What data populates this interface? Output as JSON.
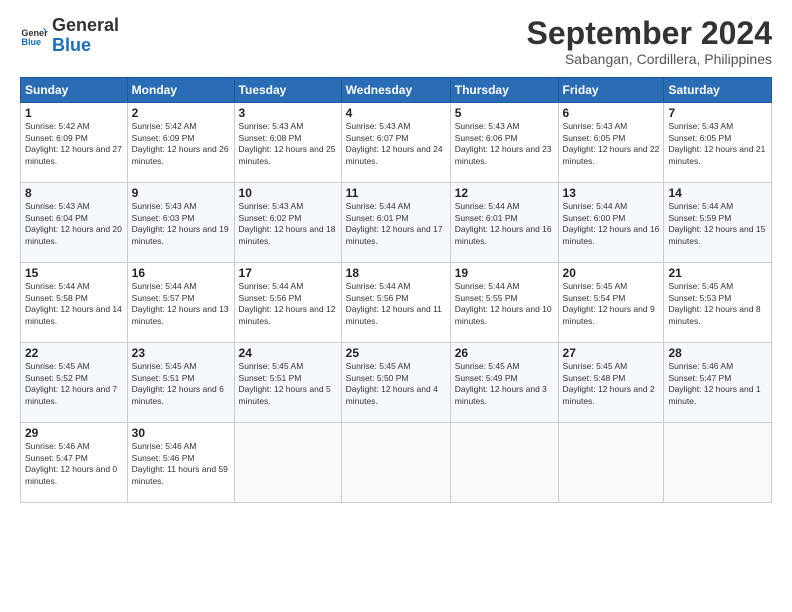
{
  "header": {
    "logo_line1": "General",
    "logo_line2": "Blue",
    "month_title": "September 2024",
    "subtitle": "Sabangan, Cordillera, Philippines"
  },
  "days_of_week": [
    "Sunday",
    "Monday",
    "Tuesday",
    "Wednesday",
    "Thursday",
    "Friday",
    "Saturday"
  ],
  "weeks": [
    [
      {
        "day": "1",
        "sunrise": "5:42 AM",
        "sunset": "6:09 PM",
        "daylight": "12 hours and 27 minutes."
      },
      {
        "day": "2",
        "sunrise": "5:42 AM",
        "sunset": "6:09 PM",
        "daylight": "12 hours and 26 minutes."
      },
      {
        "day": "3",
        "sunrise": "5:43 AM",
        "sunset": "6:08 PM",
        "daylight": "12 hours and 25 minutes."
      },
      {
        "day": "4",
        "sunrise": "5:43 AM",
        "sunset": "6:07 PM",
        "daylight": "12 hours and 24 minutes."
      },
      {
        "day": "5",
        "sunrise": "5:43 AM",
        "sunset": "6:06 PM",
        "daylight": "12 hours and 23 minutes."
      },
      {
        "day": "6",
        "sunrise": "5:43 AM",
        "sunset": "6:05 PM",
        "daylight": "12 hours and 22 minutes."
      },
      {
        "day": "7",
        "sunrise": "5:43 AM",
        "sunset": "6:05 PM",
        "daylight": "12 hours and 21 minutes."
      }
    ],
    [
      {
        "day": "8",
        "sunrise": "5:43 AM",
        "sunset": "6:04 PM",
        "daylight": "12 hours and 20 minutes."
      },
      {
        "day": "9",
        "sunrise": "5:43 AM",
        "sunset": "6:03 PM",
        "daylight": "12 hours and 19 minutes."
      },
      {
        "day": "10",
        "sunrise": "5:43 AM",
        "sunset": "6:02 PM",
        "daylight": "12 hours and 18 minutes."
      },
      {
        "day": "11",
        "sunrise": "5:44 AM",
        "sunset": "6:01 PM",
        "daylight": "12 hours and 17 minutes."
      },
      {
        "day": "12",
        "sunrise": "5:44 AM",
        "sunset": "6:01 PM",
        "daylight": "12 hours and 16 minutes."
      },
      {
        "day": "13",
        "sunrise": "5:44 AM",
        "sunset": "6:00 PM",
        "daylight": "12 hours and 16 minutes."
      },
      {
        "day": "14",
        "sunrise": "5:44 AM",
        "sunset": "5:59 PM",
        "daylight": "12 hours and 15 minutes."
      }
    ],
    [
      {
        "day": "15",
        "sunrise": "5:44 AM",
        "sunset": "5:58 PM",
        "daylight": "12 hours and 14 minutes."
      },
      {
        "day": "16",
        "sunrise": "5:44 AM",
        "sunset": "5:57 PM",
        "daylight": "12 hours and 13 minutes."
      },
      {
        "day": "17",
        "sunrise": "5:44 AM",
        "sunset": "5:56 PM",
        "daylight": "12 hours and 12 minutes."
      },
      {
        "day": "18",
        "sunrise": "5:44 AM",
        "sunset": "5:56 PM",
        "daylight": "12 hours and 11 minutes."
      },
      {
        "day": "19",
        "sunrise": "5:44 AM",
        "sunset": "5:55 PM",
        "daylight": "12 hours and 10 minutes."
      },
      {
        "day": "20",
        "sunrise": "5:45 AM",
        "sunset": "5:54 PM",
        "daylight": "12 hours and 9 minutes."
      },
      {
        "day": "21",
        "sunrise": "5:45 AM",
        "sunset": "5:53 PM",
        "daylight": "12 hours and 8 minutes."
      }
    ],
    [
      {
        "day": "22",
        "sunrise": "5:45 AM",
        "sunset": "5:52 PM",
        "daylight": "12 hours and 7 minutes."
      },
      {
        "day": "23",
        "sunrise": "5:45 AM",
        "sunset": "5:51 PM",
        "daylight": "12 hours and 6 minutes."
      },
      {
        "day": "24",
        "sunrise": "5:45 AM",
        "sunset": "5:51 PM",
        "daylight": "12 hours and 5 minutes."
      },
      {
        "day": "25",
        "sunrise": "5:45 AM",
        "sunset": "5:50 PM",
        "daylight": "12 hours and 4 minutes."
      },
      {
        "day": "26",
        "sunrise": "5:45 AM",
        "sunset": "5:49 PM",
        "daylight": "12 hours and 3 minutes."
      },
      {
        "day": "27",
        "sunrise": "5:45 AM",
        "sunset": "5:48 PM",
        "daylight": "12 hours and 2 minutes."
      },
      {
        "day": "28",
        "sunrise": "5:46 AM",
        "sunset": "5:47 PM",
        "daylight": "12 hours and 1 minute."
      }
    ],
    [
      {
        "day": "29",
        "sunrise": "5:46 AM",
        "sunset": "5:47 PM",
        "daylight": "12 hours and 0 minutes."
      },
      {
        "day": "30",
        "sunrise": "5:46 AM",
        "sunset": "5:46 PM",
        "daylight": "11 hours and 59 minutes."
      },
      null,
      null,
      null,
      null,
      null
    ]
  ]
}
